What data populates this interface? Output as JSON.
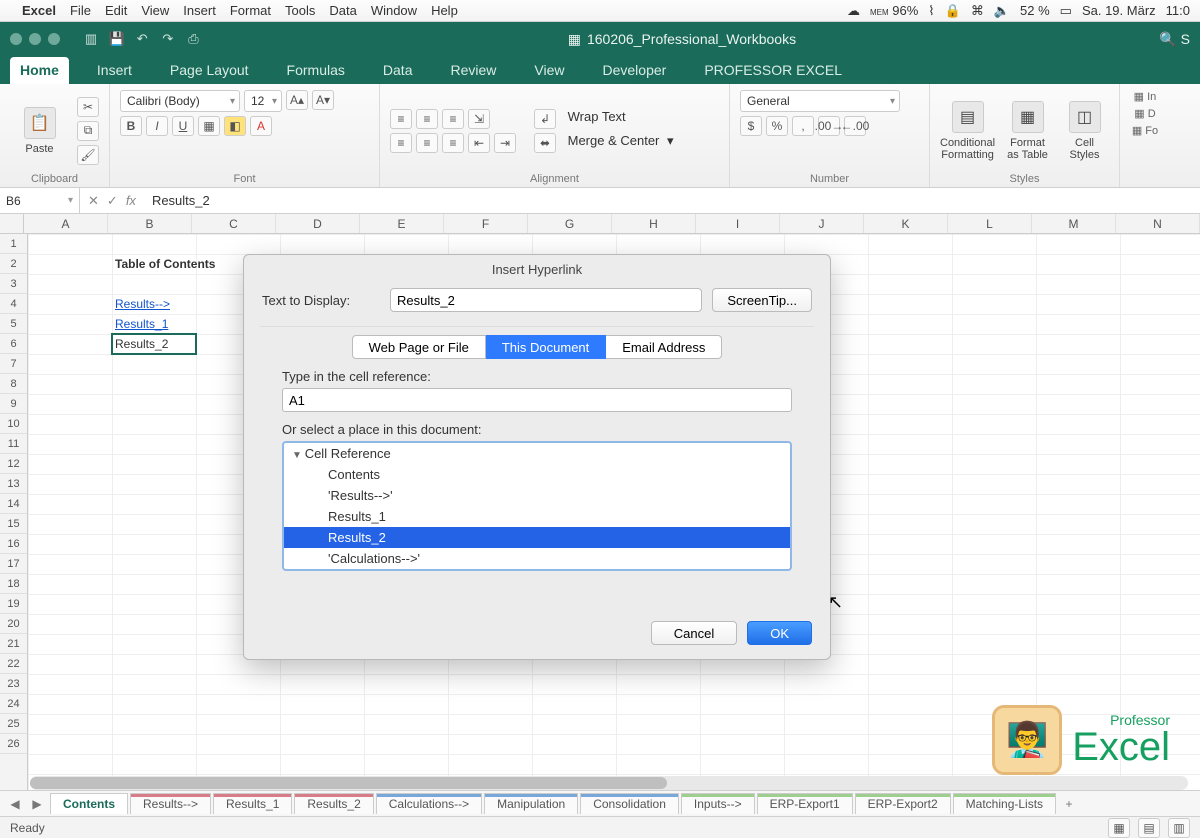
{
  "menubar": {
    "app": "Excel",
    "items": [
      "File",
      "Edit",
      "View",
      "Insert",
      "Format",
      "Tools",
      "Data",
      "Window",
      "Help"
    ],
    "right": {
      "mem": "96%",
      "mem_label": "MEM",
      "battery": "52 %",
      "date": "Sa. 19. März",
      "time": "11:0"
    }
  },
  "titlebar": {
    "doc": "160206_Professional_Workbooks"
  },
  "ribbon_tabs": [
    "Home",
    "Insert",
    "Page Layout",
    "Formulas",
    "Data",
    "Review",
    "View",
    "Developer",
    "PROFESSOR EXCEL"
  ],
  "ribbon": {
    "clipboard": {
      "paste": "Paste",
      "label": "Clipboard"
    },
    "font": {
      "name": "Calibri (Body)",
      "size": "12",
      "label": "Font"
    },
    "alignment": {
      "wrap": "Wrap Text",
      "merge": "Merge & Center",
      "label": "Alignment"
    },
    "number": {
      "format": "General",
      "label": "Number"
    },
    "styles": {
      "cf": "Conditional Formatting",
      "fat": "Format as Table",
      "cs": "Cell Styles",
      "label": "Styles"
    },
    "extra": {
      "in": "In",
      "d": "D",
      "f": "Fo"
    }
  },
  "fx": {
    "name_box": "B6",
    "formula": "Results_2"
  },
  "columns": [
    "A",
    "B",
    "C",
    "D",
    "E",
    "F",
    "G",
    "H",
    "I",
    "J",
    "K",
    "L",
    "M",
    "N"
  ],
  "rows_count": 26,
  "cells": {
    "b2": "Table of Contents",
    "b4": "Results-->",
    "b5": "Results_1",
    "b6": "Results_2"
  },
  "sheet_tabs": [
    {
      "label": "Contents",
      "color": "",
      "active": true
    },
    {
      "label": "Results-->",
      "color": "#d97c8a"
    },
    {
      "label": "Results_1",
      "color": "#d97c8a"
    },
    {
      "label": "Results_2",
      "color": "#d97c8a"
    },
    {
      "label": "Calculations-->",
      "color": "#7aa7d9"
    },
    {
      "label": "Manipulation",
      "color": "#7aa7d9"
    },
    {
      "label": "Consolidation",
      "color": "#7aa7d9"
    },
    {
      "label": "Inputs-->",
      "color": "#9fcf8f"
    },
    {
      "label": "ERP-Export1",
      "color": "#9fcf8f"
    },
    {
      "label": "ERP-Export2",
      "color": "#9fcf8f"
    },
    {
      "label": "Matching-Lists",
      "color": "#9fcf8f"
    }
  ],
  "status": {
    "left": "Ready"
  },
  "dialog": {
    "title": "Insert Hyperlink",
    "text_to_display_label": "Text to Display:",
    "text_to_display": "Results_2",
    "screentip": "ScreenTip...",
    "tabs": [
      "Web Page or File",
      "This Document",
      "Email Address"
    ],
    "active_tab": "This Document",
    "cell_ref_label": "Type in the cell reference:",
    "cell_ref": "A1",
    "or_label": "Or select a place in this document:",
    "tree_head": "Cell Reference",
    "tree_items": [
      "Contents",
      "'Results-->'",
      "Results_1",
      "Results_2",
      "'Calculations-->'"
    ],
    "selected_item": "Results_2",
    "cancel": "Cancel",
    "ok": "OK"
  },
  "watermark": {
    "brand": "Excel",
    "sub": "Professor"
  }
}
